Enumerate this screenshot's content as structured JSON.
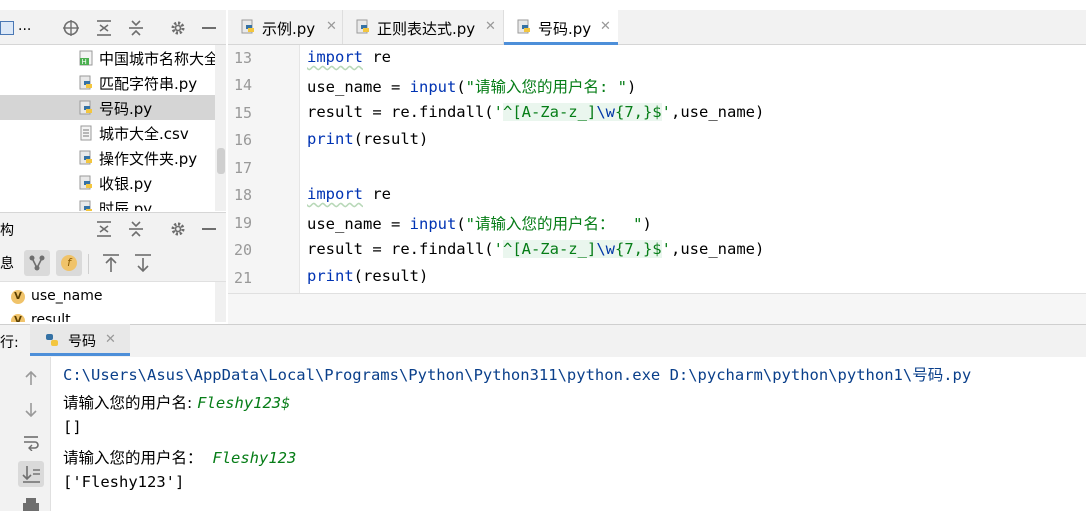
{
  "project_panel": {
    "title": "...",
    "files": [
      {
        "name": "中国城市名称大全.l",
        "icon": "html-file-icon"
      },
      {
        "name": "匹配字符串.py",
        "icon": "python-file-icon"
      },
      {
        "name": "号码.py",
        "icon": "python-file-icon",
        "selected": true
      },
      {
        "name": "城市大全.csv",
        "icon": "text-file-icon"
      },
      {
        "name": "操作文件夹.py",
        "icon": "python-file-icon"
      },
      {
        "name": "收银.py",
        "icon": "python-file-icon"
      },
      {
        "name": "时辰.py",
        "icon": "python-file-icon"
      }
    ]
  },
  "structure_panel": {
    "title": "构",
    "left_fragment": "息",
    "items": [
      {
        "name": "use_name",
        "badge": "V"
      },
      {
        "name": "result",
        "badge": "V"
      }
    ]
  },
  "editor": {
    "tabs": [
      {
        "label": "示例.py",
        "active": false
      },
      {
        "label": "正则表达式.py",
        "active": false
      },
      {
        "label": "号码.py",
        "active": true
      }
    ],
    "line_numbers": [
      "13",
      "14",
      "15",
      "16",
      "17",
      "18",
      "19",
      "20",
      "21"
    ],
    "code": {
      "l13_kw": "import",
      "l13_rest": " re",
      "l14_a": "use_name = ",
      "l14_fn": "input",
      "l14_b": "(",
      "l14_str": "\"请输入您的用户名: \"",
      "l14_c": ")",
      "l15_a": "result = re.findall(",
      "l15_q1": "'",
      "l15_rx1": "^[A-Za-z_]",
      "l15_esc": "\\w",
      "l15_rx2": "{7,}$",
      "l15_q2": "'",
      "l15_b": ",use_name)",
      "l16_fn": "print",
      "l16_b": "(result)",
      "l18_kw": "import",
      "l18_rest": " re",
      "l19_a": "use_name = ",
      "l19_fn": "input",
      "l19_b": "(",
      "l19_str": "\"请输入您的用户名：  \"",
      "l19_c": ")",
      "l20_a": "result = re.findall(",
      "l20_q1": "'",
      "l20_rx1": "^[A-Za-z_]",
      "l20_esc": "\\w",
      "l20_rx2": "{7,}$",
      "l20_q2": "'",
      "l20_b": ",use_name)",
      "l21_fn": "print",
      "l21_b": "(result)"
    }
  },
  "run_panel": {
    "label": "行:",
    "tab_label": "号码",
    "console": {
      "command": "C:\\Users\\Asus\\AppData\\Local\\Programs\\Python\\Python311\\python.exe D:\\pycharm\\python\\python1\\号码.py",
      "prompt1": "请输入您的用户名: ",
      "input1": "Fleshy123$",
      "out1": "[]",
      "prompt2": "请输入您的用户名：  ",
      "input2": "Fleshy123",
      "out2": "['Fleshy123']"
    }
  },
  "colors": {
    "keyword": "#0033b3",
    "string": "#067d17",
    "accent": "#4d8fd9",
    "selection": "#d5d5d5"
  }
}
